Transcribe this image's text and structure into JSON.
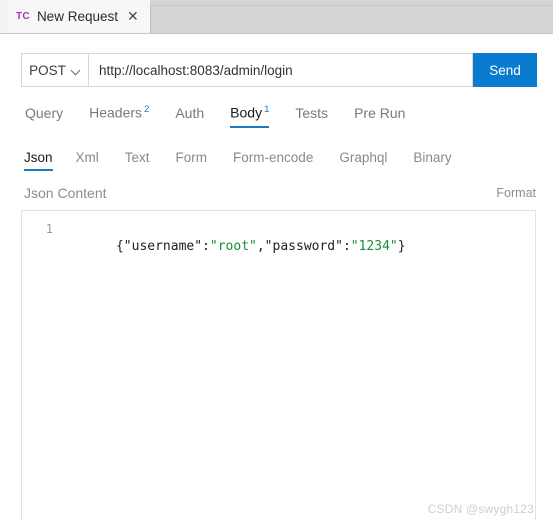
{
  "window": {
    "tab": {
      "badge": "TC",
      "title": "New Request",
      "close_icon": "close-icon"
    }
  },
  "request_bar": {
    "method": "POST",
    "method_chevron": "chevron-down-icon",
    "url": "http://localhost:8083/admin/login",
    "url_placeholder": "http://localhost:8083/admin/login",
    "send_label": "Send"
  },
  "main_tabs": [
    {
      "label": "Query",
      "badge": "",
      "active": false
    },
    {
      "label": "Headers",
      "badge": "2",
      "active": false
    },
    {
      "label": "Auth",
      "badge": "",
      "active": false
    },
    {
      "label": "Body",
      "badge": "1",
      "active": true
    },
    {
      "label": "Tests",
      "badge": "",
      "active": false
    },
    {
      "label": "Pre Run",
      "badge": "",
      "active": false
    }
  ],
  "body_tabs": [
    {
      "label": "Json",
      "active": true
    },
    {
      "label": "Xml",
      "active": false
    },
    {
      "label": "Text",
      "active": false
    },
    {
      "label": "Form",
      "active": false
    },
    {
      "label": "Form-encode",
      "active": false
    },
    {
      "label": "Graphql",
      "active": false
    },
    {
      "label": "Binary",
      "active": false
    }
  ],
  "content": {
    "title": "Json Content",
    "format_label": "Format",
    "line_number": "1",
    "code_tokens": [
      {
        "text": "{\"username\":",
        "type": "key"
      },
      {
        "text": "\"root\"",
        "type": "str"
      },
      {
        "text": ",\"password\":",
        "type": "key"
      },
      {
        "text": "\"1234\"",
        "type": "str"
      },
      {
        "text": "}",
        "type": "punc"
      }
    ],
    "code_raw": "{\"username\":\"root\",\"password\":\"1234\"}"
  },
  "watermark": "CSDN @swygh123",
  "colors": {
    "accent_blue": "#0a7bce",
    "tab_badge_purple": "#a33bb5",
    "string_green": "#1a8c3c",
    "tabstrip_gray": "#d4d4d4"
  }
}
